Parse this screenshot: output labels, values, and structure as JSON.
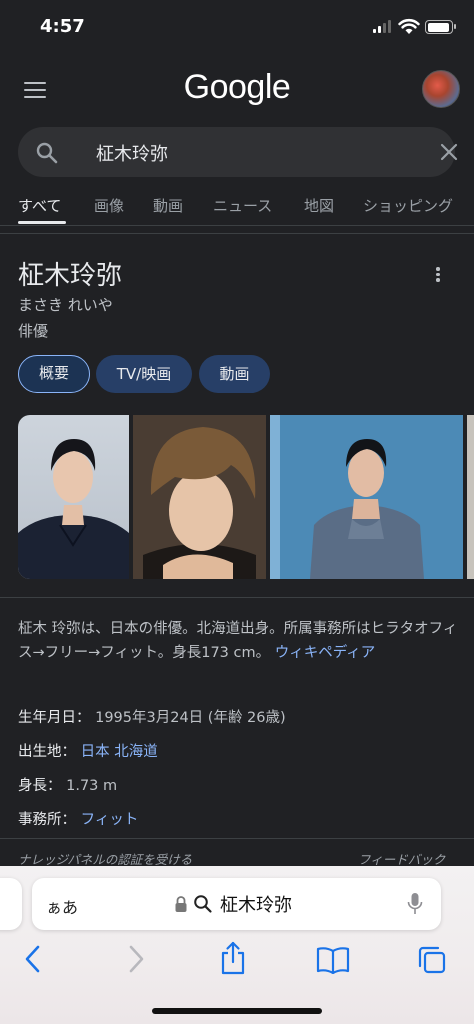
{
  "status_bar": {
    "time": "4:57"
  },
  "header": {
    "logo_text": "Google",
    "menu_icon": "hamburger-menu-icon",
    "avatar_icon": "account-avatar"
  },
  "search": {
    "query": "柾木玲弥",
    "search_icon": "search-icon",
    "clear_icon": "close-icon"
  },
  "tabs": [
    {
      "label": "すべて",
      "active": true
    },
    {
      "label": "画像"
    },
    {
      "label": "動画"
    },
    {
      "label": "ニュース"
    },
    {
      "label": "地図"
    },
    {
      "label": "ショッピング"
    }
  ],
  "knowledge_panel": {
    "title": "柾木玲弥",
    "reading": "まさき れいや",
    "type": "俳優",
    "chips": [
      {
        "label": "概要",
        "active": true
      },
      {
        "label": "TV/映画"
      },
      {
        "label": "動画"
      }
    ],
    "description": "柾木 玲弥は、日本の俳優。北海道出身。所属事務所はヒラタオフィス→フリー→フィット。身長173 cm。",
    "description_source": "ウィキペディア",
    "facts": [
      {
        "label": "生年月日：",
        "value": "1995年3月24日 (年齢 26歳)",
        "is_link": false
      },
      {
        "label": "出生地：",
        "value": "日本 北海道",
        "is_link": true
      },
      {
        "label": "身長：",
        "value": "1.73 m",
        "is_link": false
      },
      {
        "label": "事務所：",
        "value": "フィット",
        "is_link": true
      }
    ],
    "footer_left": "ナレッジパネルの認証を受ける",
    "footer_right": "フィードバック"
  },
  "safari": {
    "text_size_button": "ぁあ",
    "address_text": "柾木玲弥",
    "toolbar_icons": [
      "back-icon",
      "forward-icon",
      "share-icon",
      "bookmarks-icon",
      "tabs-icon"
    ]
  },
  "colors": {
    "background": "#202124",
    "link": "#8ab4f8",
    "text_primary": "#e8eaed",
    "text_secondary": "#bdc1c6",
    "chip_bg": "#273f67",
    "safari_blue": "#1a73e8"
  }
}
